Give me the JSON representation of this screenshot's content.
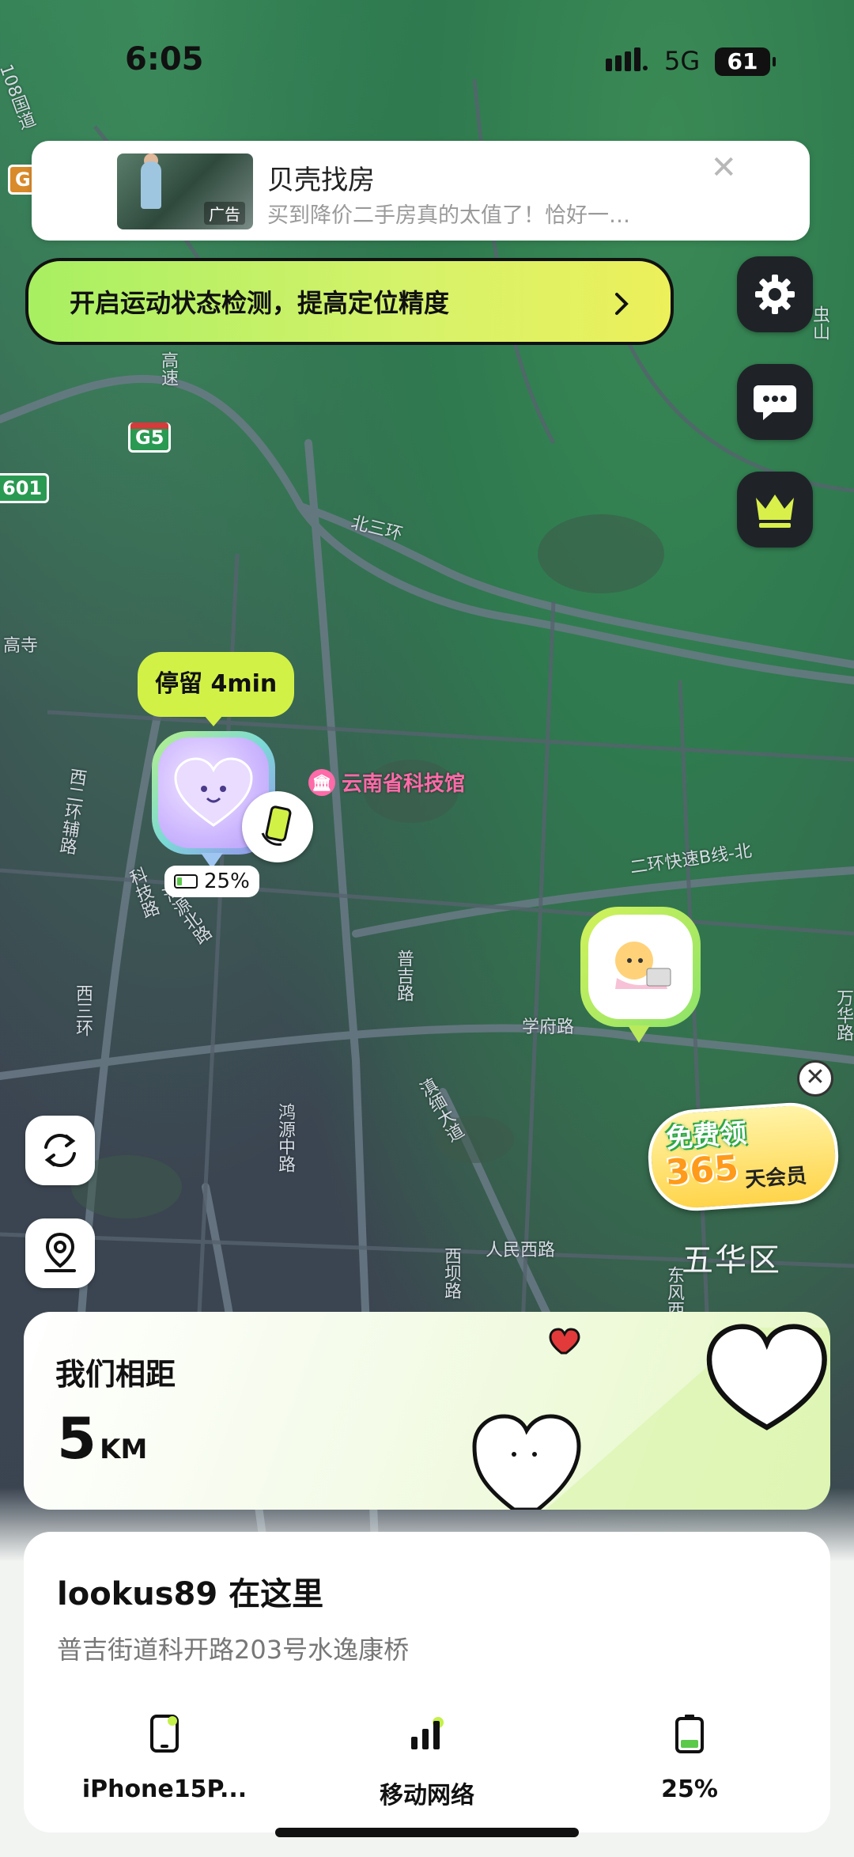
{
  "status_bar": {
    "time": "6:05",
    "network": "5G",
    "battery": "61"
  },
  "ad": {
    "title": "贝壳找房",
    "subtitle": "买到降价二手房真的太值了！恰好一…",
    "tag": "广告"
  },
  "motion_banner": {
    "label": "开启运动状态检测，提高定位精度"
  },
  "right_buttons": [
    {
      "icon": "gear-icon"
    },
    {
      "icon": "chat-icon"
    },
    {
      "icon": "crown-icon"
    }
  ],
  "map": {
    "labels": {
      "bei_san_huan": "北三环",
      "g5": "G5",
      "g_small": "G",
      "s601": "601",
      "road_108": "108国道",
      "gao_si": "高寺",
      "xi_er_huan": "西二环辅路",
      "ke_ji_lu": "科技路",
      "hai_yuan_bei_lu": "海源北路",
      "xi_san_huan": "西三环",
      "er_huan_kuaisu": "二环快速B线-北",
      "xue_fu_lu": "学府路",
      "pu_ji_lu": "普吉路",
      "dian_mian_da_dao": "滇缅大道",
      "hong_yuan": "鸿源中路",
      "ren_min_xi_lu": "人民西路",
      "xi_ba_lu": "西坝路",
      "dong_feng": "东风西",
      "wan_hua": "万华路",
      "chong_shan": "虫山",
      "gao_su": "高速",
      "district": "五华区"
    },
    "poi": {
      "name": "云南省科技馆",
      "icon": "museum-icon"
    }
  },
  "marker_self": {
    "stay_label": "停留 4min",
    "battery": "25%"
  },
  "promo": {
    "line1": "免费领",
    "line2": "365",
    "line3": "天会员"
  },
  "distance": {
    "title": "我们相距",
    "value": "5",
    "unit": "KM"
  },
  "info": {
    "title": "lookus89 在这里",
    "address": "普吉街道科开路203号水逸康桥",
    "stats": [
      {
        "label": "iPhone15P...",
        "icon": "phone-icon"
      },
      {
        "label": "移动网络",
        "icon": "cellular-icon"
      },
      {
        "label": "25%",
        "icon": "battery-icon"
      }
    ]
  },
  "colors": {
    "accent": "#d2f147",
    "marker_green": "#8ce36a",
    "dark_button": "#1f2328"
  }
}
